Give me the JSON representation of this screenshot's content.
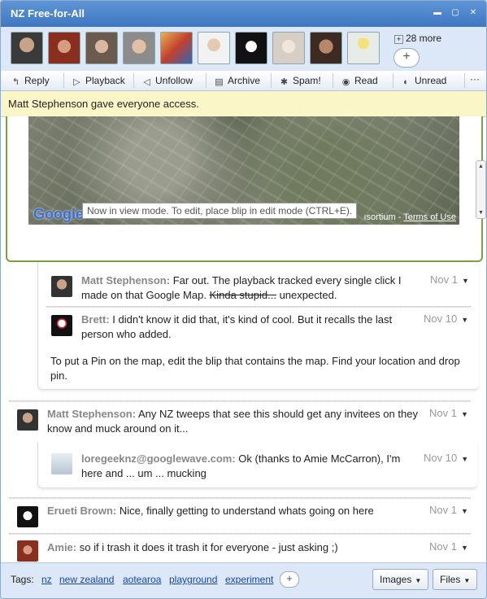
{
  "window": {
    "title": "NZ Free-for-All"
  },
  "participants": {
    "more_label": "28 more",
    "add_label": "+",
    "expand_symbol": "+"
  },
  "toolbar": {
    "items": [
      "Reply",
      "Playback",
      "Unfollow",
      "Archive",
      "Spam!",
      "Read",
      "Unread"
    ],
    "overflow": "···"
  },
  "notice": {
    "text": "Matt Stephenson gave everyone access."
  },
  "map": {
    "logo": "Google",
    "tooltip": "Now in view mode. To edit, place blip in edit mode (CTRL+E).",
    "credit_left": "ısortium -",
    "terms": "Terms of Use"
  },
  "blips": [
    {
      "author": "Matt Stephenson:",
      "text_before": "Far out. The playback tracked every single click I made on that Google Map.",
      "strike": "Kinda stupid...",
      "text_after": "unexpected.",
      "date": "Nov 1"
    },
    {
      "author": "Brett:",
      "text": "I didn't know it did that, it's kind of cool.  But it recalls the last person who added.",
      "date": "Nov 10"
    },
    {
      "text": "To put a Pin on the map, edit the blip that contains the map. Find your location and drop pin."
    },
    {
      "author": "Matt Stephenson:",
      "text": "Any NZ tweeps that see this should get any invitees on they know and muck around on it...",
      "date": "Nov 1"
    },
    {
      "author": "loregeeknz@googlewave.com:",
      "text": "Ok (thanks to Amie McCarron), I'm here and ... um ... mucking",
      "date": "Nov 10"
    },
    {
      "author": "Erueti Brown:",
      "text": "Nice, finally getting to understand whats going on here",
      "date": "Nov 1"
    },
    {
      "author": "Amie:",
      "text": "so if i trash it does it trash it for everyone - just asking ;)",
      "date": "Nov 1"
    }
  ],
  "footer": {
    "tags_label": "Tags:",
    "tags": [
      "nz",
      "new zealand",
      "aotearoa",
      "playground",
      "experiment"
    ],
    "add_tag": "+",
    "images_label": "Images",
    "files_label": "Files"
  }
}
